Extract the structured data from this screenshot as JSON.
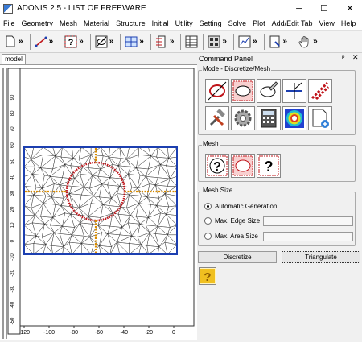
{
  "window": {
    "title": "ADONIS 2.5 - LIST OF FREEWARE",
    "minimize": "─",
    "maximize": "☐",
    "close": "✕"
  },
  "menu": [
    "File",
    "Geometry",
    "Mesh",
    "Material",
    "Structure",
    "Initial",
    "Utility",
    "Setting",
    "Solve",
    "Plot",
    "Add/Edit Tab",
    "View",
    "Help"
  ],
  "toolbar": {
    "more": "»"
  },
  "tabs": {
    "model": "model"
  },
  "plot": {
    "x_ticks": [
      "-120",
      "-100",
      "-80",
      "-60",
      "-40",
      "-20",
      "0"
    ],
    "y_ticks": [
      "90",
      "80",
      "70",
      "60",
      "50",
      "40",
      "30",
      "20",
      "10",
      "0",
      "-10",
      "-20",
      "-30",
      "-40",
      "-50"
    ],
    "boundary_color": "#1c3fb0",
    "circle_color": "#c0141a",
    "crack_color": "#d98c00"
  },
  "command_panel": {
    "title": "Command Panel",
    "pin": "ᵖ",
    "close": "✕",
    "mode_group": "Mode - Discretize/Mesh",
    "mesh_group": "Mesh",
    "mesh_size_group": "Mesh Size",
    "mesh_size_options": {
      "auto": "Automatic Generation",
      "edge": "Max. Edge Size",
      "area": "Max. Area Size"
    },
    "buttons": {
      "discretize": "Discretize",
      "triangulate": "Triangulate"
    },
    "help": "?"
  }
}
